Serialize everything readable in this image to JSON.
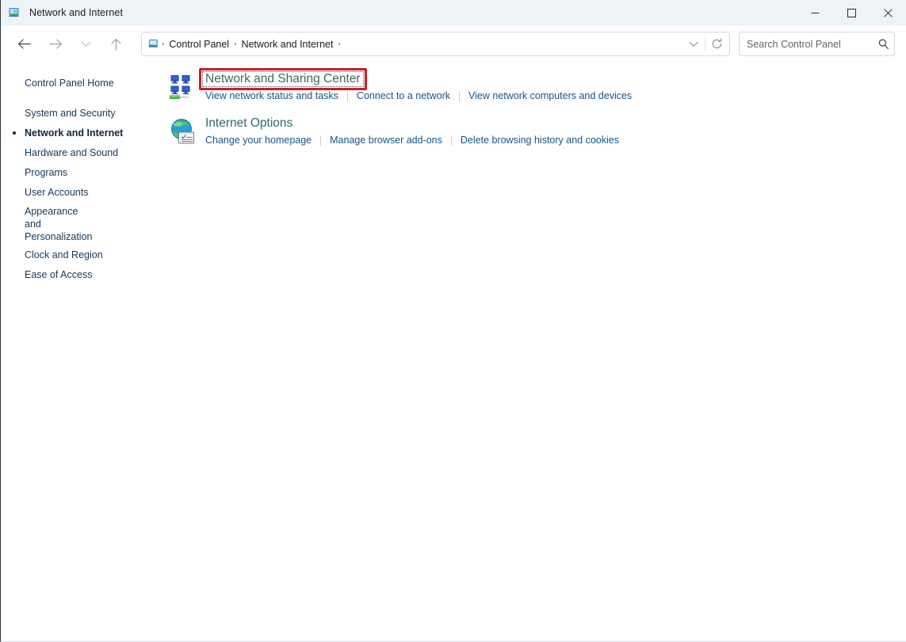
{
  "window": {
    "title": "Network and Internet",
    "icon": "network-folder-icon",
    "controls": {
      "minimize": "Minimize",
      "maximize": "Maximize",
      "close": "Close"
    }
  },
  "toolbar": {
    "back": "Back",
    "forward": "Forward",
    "recent": "Recent locations",
    "up": "Up one level",
    "refresh": "Refresh",
    "dropdown": "Previous locations"
  },
  "address": {
    "icon": "control-panel-icon",
    "crumbs": [
      "Control Panel",
      "Network and Internet"
    ],
    "separator": "›"
  },
  "search": {
    "placeholder": "Search Control Panel",
    "value": "",
    "icon": "search-icon"
  },
  "sidebar": {
    "home": "Control Panel Home",
    "items": [
      {
        "label": "System and Security",
        "current": false
      },
      {
        "label": "Network and Internet",
        "current": true
      },
      {
        "label": "Hardware and Sound",
        "current": false
      },
      {
        "label": "Programs",
        "current": false
      },
      {
        "label": "User Accounts",
        "current": false
      },
      {
        "label": "Appearance and Personalization",
        "current": false
      },
      {
        "label": "Clock and Region",
        "current": false
      },
      {
        "label": "Ease of Access",
        "current": false
      }
    ]
  },
  "main": {
    "categories": [
      {
        "title": "Network and Sharing Center",
        "icon": "network-computers-icon",
        "highlighted": true,
        "links": [
          "View network status and tasks",
          "Connect to a network",
          "View network computers and devices"
        ]
      },
      {
        "title": "Internet Options",
        "icon": "internet-globe-options-icon",
        "highlighted": false,
        "links": [
          "Change your homepage",
          "Manage browser add-ons",
          "Delete browsing history and cookies"
        ]
      }
    ]
  },
  "colors": {
    "highlight_border": "#c42026",
    "category_title": "#2d6a6c",
    "link": "#16538c",
    "titlebar_bg": "#eef4f6"
  }
}
